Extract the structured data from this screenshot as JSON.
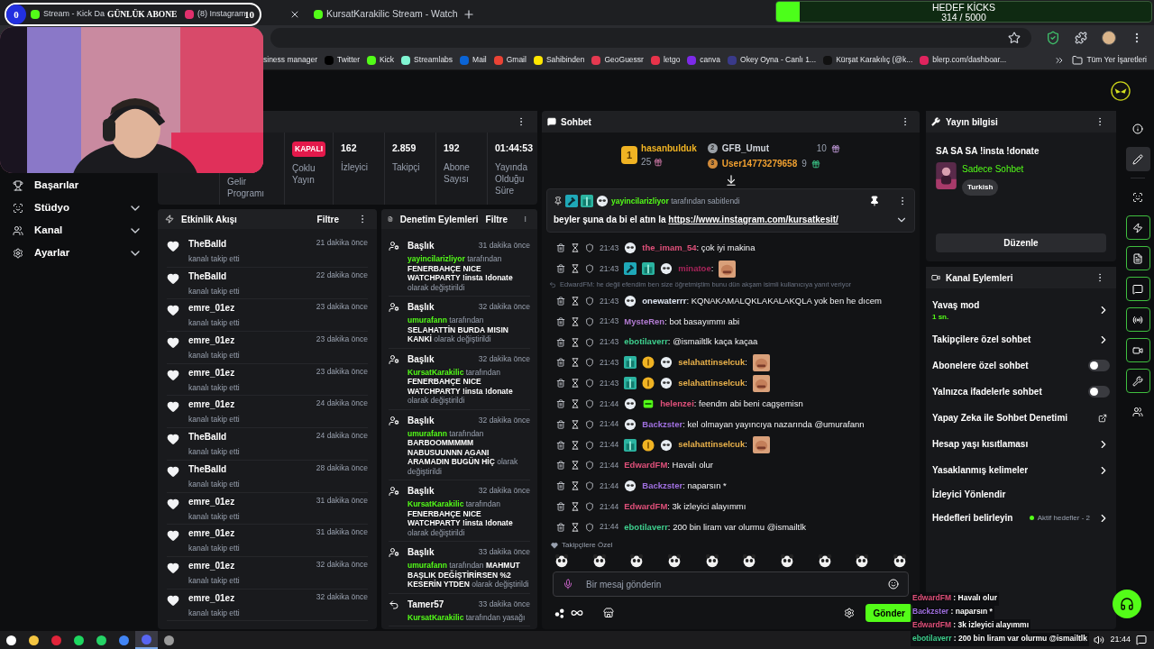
{
  "subscriber_counter": {
    "count": "0",
    "title": "GÜNLÜK ABONE",
    "goal": "10"
  },
  "kick_goal": {
    "title": "HEDEF KİCKS",
    "progress": "314 / 5000",
    "level": 0.063
  },
  "browser": {
    "tabs": [
      {
        "title": "Stream - Kick Da"
      },
      {
        "title": "(8) Instagram"
      },
      {
        "title": "KursatKarakilic Stream - Watch"
      }
    ],
    "bookmarks": [
      "siness manager",
      "Twitter",
      "Kick",
      "Streamlabs",
      "Mail",
      "Gmail",
      "Sahibinden",
      "GeoGuessr",
      "letgo",
      "canva",
      "Okey Oyna - Canlı 1...",
      "Kürşat Karakılıç (@k...",
      "blerp.com/dashboar..."
    ],
    "all_bookmarks": "Tüm Yer İşaretleri"
  },
  "sidebar": {
    "items": [
      {
        "label": "Başarılar",
        "expandable": false
      },
      {
        "label": "Stüdyo",
        "expandable": true
      },
      {
        "label": "Kanal",
        "expandable": true
      },
      {
        "label": "Ayarlar",
        "expandable": true
      }
    ]
  },
  "stats": [
    {
      "kind": "label",
      "label": "Gelir Programı"
    },
    {
      "kind": "badge",
      "value": "KAPALI",
      "label": "Çoklu Yayın"
    },
    {
      "kind": "stat",
      "value": "162",
      "label": "İzleyici"
    },
    {
      "kind": "stat",
      "value": "2.859",
      "label": "Takipçi"
    },
    {
      "kind": "stat",
      "value": "192",
      "label": "Abone Sayısı"
    },
    {
      "kind": "stat",
      "value": "01:44:53",
      "label": "Yayında Olduğu Süre"
    }
  ],
  "activity_feed": {
    "title": "Etkinlik Akışı",
    "filter": "Filtre",
    "events": [
      {
        "user": "TheBalld",
        "action": "kanalı takip etti",
        "time": "21 dakika önce"
      },
      {
        "user": "TheBalld",
        "action": "kanalı takip etti",
        "time": "22 dakika önce"
      },
      {
        "user": "emre_01ez",
        "action": "kanalı takip etti",
        "time": "23 dakika önce"
      },
      {
        "user": "emre_01ez",
        "action": "kanalı takip etti",
        "time": "23 dakika önce"
      },
      {
        "user": "emre_01ez",
        "action": "kanalı takip etti",
        "time": "23 dakika önce"
      },
      {
        "user": "emre_01ez",
        "action": "kanalı takip etti",
        "time": "24 dakika önce"
      },
      {
        "user": "TheBalld",
        "action": "kanalı takip etti",
        "time": "24 dakika önce"
      },
      {
        "user": "TheBalld",
        "action": "kanalı takip etti",
        "time": "28 dakika önce"
      },
      {
        "user": "emre_01ez",
        "action": "kanalı takip etti",
        "time": "31 dakika önce"
      },
      {
        "user": "emre_01ez",
        "action": "kanalı takip etti",
        "time": "31 dakika önce"
      },
      {
        "user": "emre_01ez",
        "action": "kanalı takip etti",
        "time": "32 dakika önce"
      },
      {
        "user": "emre_01ez",
        "action": "kanalı takip etti",
        "time": "32 dakika önce"
      }
    ]
  },
  "moderation_log": {
    "title": "Denetim Eylemleri",
    "filter": "Filtre",
    "entries": [
      {
        "kind": "title",
        "heading": "Başlık",
        "time": "31 dakika önce",
        "user": "yayincilarizliyor",
        "action": "tarafından",
        "value": "FENERBAHÇE NICE WATCHPARTY !insta !donate",
        "suffix": "olarak değiştirildi"
      },
      {
        "kind": "title",
        "heading": "Başlık",
        "time": "32 dakika önce",
        "user": "umurafann",
        "action": "tarafından",
        "value": "SELAHATTİN BURDA MISIN KANKİ",
        "suffix": "olarak değiştirildi"
      },
      {
        "kind": "title",
        "heading": "Başlık",
        "time": "32 dakika önce",
        "user": "KursatKarakilic",
        "action": "tarafından",
        "value": "FENERBAHÇE NICE WATCHPARTY !insta !donate",
        "suffix": "olarak değiştirildi"
      },
      {
        "kind": "title",
        "heading": "Başlık",
        "time": "32 dakika önce",
        "user": "umurafann",
        "action": "tarafından",
        "value": "BARBOOMMMMM NABUSUUNNN AGANI ARAMADIN BUGÜN HİÇ",
        "suffix": "olarak değiştirildi"
      },
      {
        "kind": "title",
        "heading": "Başlık",
        "time": "32 dakika önce",
        "user": "KursatKarakilic",
        "action": "tarafından",
        "value": "FENERBAHÇE NICE WATCHPARTY !insta !donate",
        "suffix": "olarak değiştirildi"
      },
      {
        "kind": "title",
        "heading": "Başlık",
        "time": "33 dakika önce",
        "user": "umurafann",
        "action": "tarafından",
        "value": "MAHMUT BAŞLIK DEĞİŞTİRİRSEN %2 KESERİN YTDEN",
        "suffix": "olarak değiştirildi"
      },
      {
        "kind": "unban",
        "heading": "Tamer57",
        "time": "33 dakika önce",
        "user": "KursatKarakilic",
        "action": "tarafından yasağı"
      }
    ]
  },
  "chat": {
    "title": "Sohbet",
    "leaderboard": [
      {
        "rank": "1",
        "user": "hasanbulduk",
        "count": "25"
      },
      {
        "rank": "2",
        "user": "GFB_Umut",
        "count": "10"
      },
      {
        "rank": "3",
        "user": "User14773279658",
        "count": "9"
      }
    ],
    "pinned": {
      "user": "yayincilarizliyor",
      "note": "tarafından sabitlendi",
      "text": "beyler şuna da bi el atın la",
      "link": "https://www.instagram.com/kursatkesit/"
    },
    "messages": [
      {
        "time": "21:43",
        "badges": [
          {
            "kind": "panda"
          }
        ],
        "user": "the_imam_54",
        "color": "#e0507a",
        "text": ": çok iyi makina",
        "emote": false
      },
      {
        "time": "21:43",
        "badges": [
          {
            "kind": "hammer"
          },
          {
            "kind": "gift"
          },
          {
            "kind": "panda"
          }
        ],
        "user": "minatoe",
        "color": "#a8245a",
        "text": ":",
        "emote": true
      },
      {
        "time": "21:43",
        "badges": [
          {
            "kind": "panda"
          }
        ],
        "user": "onewaterrr",
        "color": "#dfe6f2",
        "text": ": KQNAKAMALQKLAKALAKQLA yok ben he dıcem",
        "emote": false,
        "reply": "EdwardFM: he değil efendim ben size öğretmiştim bunu dün akşam isimli kullanıcıya yanıt veriyor"
      },
      {
        "time": "21:43",
        "user": "MysteRen",
        "color": "#b07ad0",
        "text": ": bot basayımmı abi",
        "emote": false
      },
      {
        "time": "21:43",
        "user": "ebotilaverr",
        "color": "#3ecf8e",
        "text": ": @ismailtlk kaça kaçaa",
        "emote": false
      },
      {
        "time": "21:43",
        "badges": [
          {
            "kind": "gift"
          },
          {
            "kind": "coin"
          },
          {
            "kind": "panda"
          }
        ],
        "user": "selahattinselcuk",
        "color": "#e8b04a",
        "text": ":",
        "emote": true
      },
      {
        "time": "21:43",
        "badges": [
          {
            "kind": "gift"
          },
          {
            "kind": "coin"
          },
          {
            "kind": "panda"
          }
        ],
        "user": "selahattinselcuk",
        "color": "#e8b04a",
        "text": ":",
        "emote": true
      },
      {
        "time": "21:44",
        "badges": [
          {
            "kind": "panda"
          },
          {
            "kind": "sub"
          }
        ],
        "user": "helenzei",
        "color": "#e0507a",
        "text": ": feendm abi beni cagşemisn",
        "emote": false
      },
      {
        "time": "21:44",
        "badges": [
          {
            "kind": "panda"
          }
        ],
        "user": "Backzster",
        "color": "#a070e0",
        "text": ": kel olmayan yayıncıya nazarında @umurafann",
        "emote": false
      },
      {
        "time": "21:44",
        "badges": [
          {
            "kind": "gift"
          },
          {
            "kind": "coin"
          },
          {
            "kind": "panda"
          }
        ],
        "user": "selahattinselcuk",
        "color": "#e8b04a",
        "text": ":",
        "emote": true
      },
      {
        "time": "21:44",
        "user": "EdwardFM",
        "color": "#e0507a",
        "text": ": Havalı olur",
        "emote": false
      },
      {
        "time": "21:44",
        "badges": [
          {
            "kind": "panda"
          }
        ],
        "user": "Backzster",
        "color": "#a070e0",
        "text": ": naparsın *",
        "emote": false
      },
      {
        "time": "21:44",
        "user": "EdwardFM",
        "color": "#e0507a",
        "text": ": 3k izleyici alayımmı",
        "emote": false
      },
      {
        "time": "21:44",
        "user": "ebotilaverr",
        "color": "#3ecf8e",
        "text": ": 200 bin liram var olurmu @ismailtlk",
        "emote": false
      }
    ],
    "emote_section": "Takipçilere Özel",
    "input": {
      "placeholder": "Bir mesaj gönderin"
    },
    "send": "Gönder"
  },
  "stream_info": {
    "title": "Yayın bilgisi",
    "stream_title": "SA SA SA !insta !donate",
    "category": "Sadece Sohbet",
    "tag": "Turkish",
    "edit": "Düzenle"
  },
  "channel_actions": {
    "title": "Kanal Eylemleri",
    "items": [
      {
        "kind": "submenu",
        "label": "Yavaş mod",
        "detail": "1 sn."
      },
      {
        "kind": "submenu",
        "label": "Takipçilere özel sohbet"
      },
      {
        "kind": "toggle",
        "label": "Abonelere özel sohbet",
        "on": false
      },
      {
        "kind": "toggle",
        "label": "Yalnızca ifadelerle sohbet",
        "on": false
      },
      {
        "kind": "external",
        "label": "Yapay Zeka ile Sohbet Denetimi"
      },
      {
        "kind": "submenu",
        "label": "Hesap yaşı kısıtlaması"
      },
      {
        "kind": "submenu",
        "label": "Yasaklanmış kelimeler"
      },
      {
        "kind": "plain",
        "label": "İzleyici Yönlendir"
      },
      {
        "kind": "status",
        "label": "Hedefleri belirleyin",
        "status": "Aktif hedefler - 2"
      }
    ]
  },
  "rail": [
    {
      "selected": false,
      "pinned": false
    },
    {
      "selected": true,
      "pinned": false
    },
    {
      "selected": false,
      "pinned": false
    },
    {
      "selected": false,
      "pinned": true
    },
    {
      "selected": false,
      "pinned": true
    },
    {
      "selected": false,
      "pinned": true
    },
    {
      "selected": false,
      "pinned": true
    },
    {
      "selected": false,
      "pinned": true
    },
    {
      "selected": false,
      "pinned": true
    },
    {
      "selected": false,
      "pinned": false
    }
  ],
  "chat_overlay": [
    {
      "user": "EdwardFM",
      "color": "#e0507a",
      "text": ": Havalı olur"
    },
    {
      "user": "Backzster",
      "color": "#a070e0",
      "text": ": naparsın *"
    },
    {
      "user": "EdwardFM",
      "color": "#e0507a",
      "text": ": 3k izleyici alayımmı"
    },
    {
      "user": "ebotilaverr",
      "color": "#3ecf8e",
      "text": ": 200 bin liram var olurmu @ismailtlk"
    }
  ],
  "taskbar": {
    "apps": [
      {
        "active": false
      },
      {
        "active": false
      },
      {
        "active": false
      },
      {
        "active": false
      },
      {
        "active": false
      },
      {
        "active": false
      },
      {
        "active": true
      },
      {
        "active": false
      }
    ],
    "clock": "21:44"
  }
}
